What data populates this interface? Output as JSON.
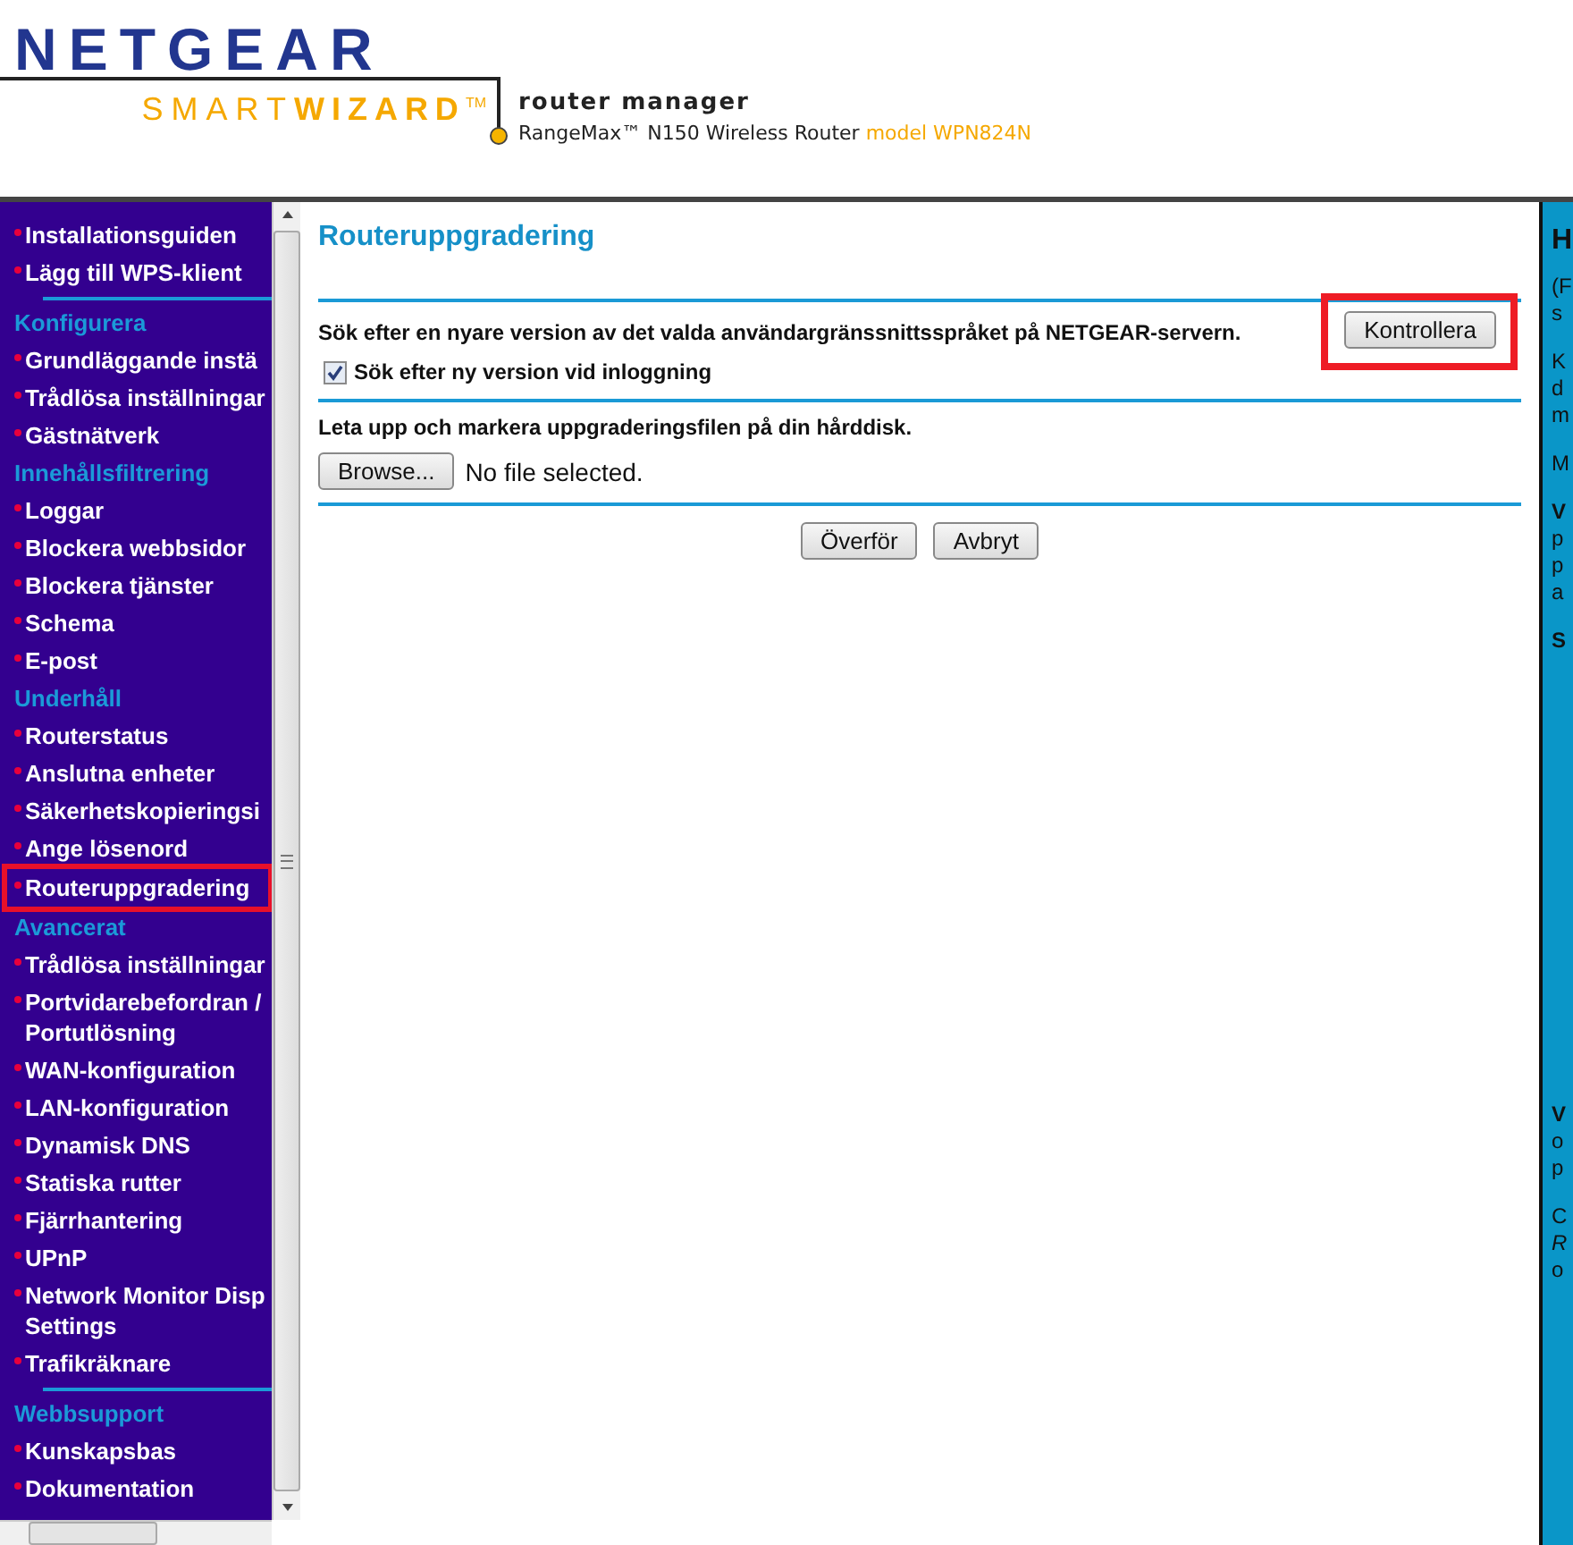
{
  "header": {
    "brand": "NETGEAR",
    "product_light": "SMART",
    "product_bold": "WIZARD",
    "trademark": "TM",
    "subtitle": "router manager",
    "device": "RangeMax™ N150 Wireless Router",
    "model": "model WPN824N"
  },
  "sidebar": {
    "items": [
      {
        "kind": "link",
        "label": "Installationsguiden",
        "selected": false
      },
      {
        "kind": "link",
        "label": "Lägg till WPS-klient",
        "selected": false
      },
      {
        "kind": "divider"
      },
      {
        "kind": "heading",
        "label": "Konfigurera"
      },
      {
        "kind": "link",
        "label": "Grundläggande instä",
        "selected": false
      },
      {
        "kind": "link",
        "label": "Trådlösa inställningar",
        "selected": false
      },
      {
        "kind": "link",
        "label": "Gästnätverk",
        "selected": false
      },
      {
        "kind": "heading",
        "label": "Innehållsfiltrering"
      },
      {
        "kind": "link",
        "label": "Loggar",
        "selected": false
      },
      {
        "kind": "link",
        "label": "Blockera webbsidor",
        "selected": false
      },
      {
        "kind": "link",
        "label": "Blockera tjänster",
        "selected": false
      },
      {
        "kind": "link",
        "label": "Schema",
        "selected": false
      },
      {
        "kind": "link",
        "label": "E-post",
        "selected": false
      },
      {
        "kind": "heading",
        "label": "Underhåll"
      },
      {
        "kind": "link",
        "label": "Routerstatus",
        "selected": false
      },
      {
        "kind": "link",
        "label": "Anslutna enheter",
        "selected": false
      },
      {
        "kind": "link",
        "label": "Säkerhetskopieringsi",
        "selected": false
      },
      {
        "kind": "link",
        "label": "Ange lösenord",
        "selected": false
      },
      {
        "kind": "link",
        "label": "Routeruppgradering",
        "selected": true
      },
      {
        "kind": "heading",
        "label": "Avancerat"
      },
      {
        "kind": "link",
        "label": "Trådlösa inställningar",
        "selected": false
      },
      {
        "kind": "link",
        "label": "Portvidarebefordran / Portutlösning",
        "selected": false
      },
      {
        "kind": "link",
        "label": "WAN-konfiguration",
        "selected": false
      },
      {
        "kind": "link",
        "label": "LAN-konfiguration",
        "selected": false
      },
      {
        "kind": "link",
        "label": "Dynamisk DNS",
        "selected": false
      },
      {
        "kind": "link",
        "label": "Statiska rutter",
        "selected": false
      },
      {
        "kind": "link",
        "label": "Fjärrhantering",
        "selected": false
      },
      {
        "kind": "link",
        "label": "UPnP",
        "selected": false
      },
      {
        "kind": "link",
        "label": "Network Monitor Disp Settings",
        "selected": false
      },
      {
        "kind": "link",
        "label": "Trafikräknare",
        "selected": false
      },
      {
        "kind": "divider"
      },
      {
        "kind": "heading",
        "label": "Webbsupport"
      },
      {
        "kind": "link",
        "label": "Kunskapsbas",
        "selected": false
      },
      {
        "kind": "link",
        "label": "Dokumentation",
        "selected": false
      }
    ]
  },
  "main": {
    "title": "Routeruppgradering",
    "check_text": "Sök efter en nyare version av det valda användargränssnittsspråket på NETGEAR-servern.",
    "check_button": {
      "label": "Kontrollera",
      "highlighted": true
    },
    "auto_check": {
      "label": "Sök efter ny version vid inloggning",
      "checked": true
    },
    "file_text": "Leta upp och markera uppgraderingsfilen på din hårddisk.",
    "browse_button": "Browse...",
    "file_status": "No file selected.",
    "buttons": [
      "Överför",
      "Avbryt"
    ]
  },
  "help": {
    "upper": [
      {
        "kind": "heading",
        "lines": [
          "H"
        ]
      },
      {
        "kind": "text",
        "lines": [
          "(F",
          "s"
        ]
      },
      {
        "kind": "text",
        "lines": [
          "K",
          "d",
          "m"
        ]
      },
      {
        "kind": "text",
        "lines": [
          "M"
        ]
      },
      {
        "kind": "text",
        "lines": [
          "**V**",
          "p",
          "p",
          "a"
        ]
      },
      {
        "kind": "text",
        "lines": [
          "**S**"
        ]
      }
    ],
    "lower": [
      {
        "kind": "text",
        "lines": [
          "**V**",
          "o",
          "p"
        ]
      },
      {
        "kind": "text",
        "lines": [
          "C",
          "*R*",
          "o"
        ]
      }
    ]
  }
}
